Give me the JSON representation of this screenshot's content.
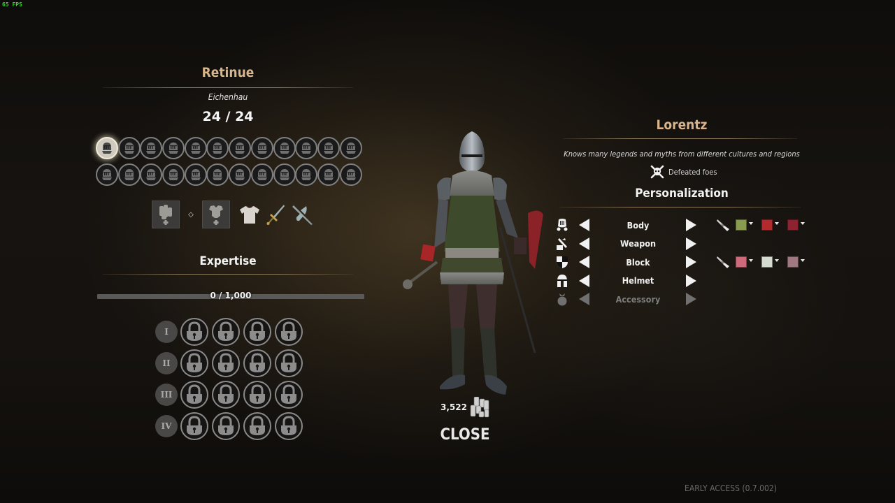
{
  "overlay": {
    "fps": "65 FPS"
  },
  "retinue": {
    "title": "Retinue",
    "location": "Eichenhau",
    "count": "24 / 24",
    "member_count": 24,
    "selected_index": 0
  },
  "equipment": {
    "slots": [
      {
        "name": "coins-slot",
        "icon": "coin-stack-icon"
      },
      {
        "name": "armor-slot",
        "icon": "armor-icon"
      }
    ],
    "separator": "◇",
    "items": [
      {
        "name": "tunic",
        "icon": "tunic-icon"
      },
      {
        "name": "sword",
        "icon": "sword-icon"
      },
      {
        "name": "axe",
        "icon": "axe-icon"
      }
    ]
  },
  "expertise": {
    "title": "Expertise",
    "progress_text": "0 / 1,000",
    "current": 0,
    "max": 1000,
    "tiers": [
      {
        "label": "I",
        "locked_slots": 4
      },
      {
        "label": "II",
        "locked_slots": 4
      },
      {
        "label": "III",
        "locked_slots": 4
      },
      {
        "label": "IV",
        "locked_slots": 4
      }
    ]
  },
  "character": {
    "name": "Lorentz",
    "description": "Knows many legends and myths from different cultures and regions",
    "trait": {
      "icon": "skull-crossbones-icon",
      "label": "Defeated foes"
    },
    "gold": "3,522",
    "close_label": "CLOSE"
  },
  "personalization": {
    "title": "Personalization",
    "rows": [
      {
        "label": "Body",
        "icon": "body-armor-icon",
        "enabled": true,
        "colors": [
          "#8a9a4e",
          "#b32a2e",
          "#8e2230"
        ]
      },
      {
        "label": "Weapon",
        "icon": "weapon-icon",
        "enabled": true,
        "colors": []
      },
      {
        "label": "Block",
        "icon": "shield-icon",
        "enabled": true,
        "colors": [
          "#d06a7a",
          "#d5dccf",
          "#a07880"
        ]
      },
      {
        "label": "Helmet",
        "icon": "helmet-icon",
        "enabled": true,
        "colors": []
      },
      {
        "label": "Accessory",
        "icon": "accessory-icon",
        "enabled": false,
        "colors": []
      }
    ]
  },
  "footer": {
    "version": "EARLY ACCESS  (0.7.002)"
  }
}
